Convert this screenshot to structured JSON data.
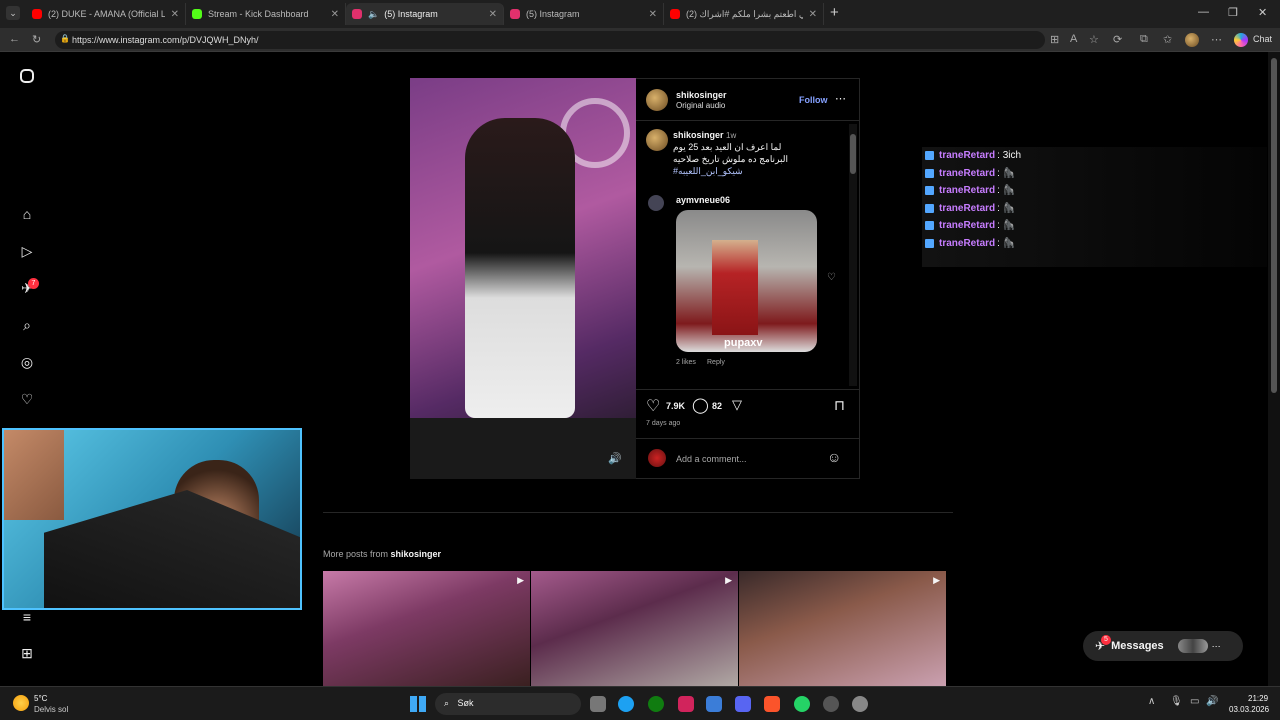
{
  "browser": {
    "tabs": [
      {
        "label": "(2) DUKE - AMANA (Official Lyric V",
        "color": "#ff0000"
      },
      {
        "label": "Stream - Kick Dashboard",
        "color": "#53fc18"
      },
      {
        "label": "(5) Instagram",
        "color": "#e1306c"
      },
      {
        "label": "(5) Instagram",
        "color": "#e1306c"
      },
      {
        "label": "(2) ولني اطعتم بشرا ملكم #اشراك_",
        "color": "#ff0000"
      }
    ],
    "new_tab": "+",
    "url": "https://www.instagram.com/p/DVJQWH_DNyh/",
    "chat_label": "Chat"
  },
  "sidebar": {
    "notifications_badge": "7"
  },
  "post": {
    "username": "shikosinger",
    "audio": "Original audio",
    "follow": "Follow",
    "caption_user": "shikosinger",
    "caption_time": "1w",
    "caption_line1": "لما اعرف ان العيد بعد 25 يوم",
    "caption_line2": "البرنامج ده ملوش تاريخ صلاحيه",
    "caption_hashtag": "#شيكو_ابن_اللعيبه",
    "comment_user": "aymvneue06",
    "comment_watermark": "pupaxv",
    "comment_likes": "2 likes",
    "comment_reply": "Reply",
    "likes": "7.9K",
    "comments": "82",
    "posted": "7 days ago",
    "add_comment_placeholder": "Add a comment..."
  },
  "more_posts": {
    "prefix": "More posts from ",
    "user": "shikosinger"
  },
  "chat_overlay": {
    "lines": [
      {
        "user": "traneRetard",
        "msg": ": 3ich"
      },
      {
        "user": "traneRetard",
        "msg": ": 🦍"
      },
      {
        "user": "traneRetard",
        "msg": ": 🦍"
      },
      {
        "user": "traneRetard",
        "msg": ": 🦍"
      },
      {
        "user": "traneRetard",
        "msg": ": 🦍"
      },
      {
        "user": "traneRetard",
        "msg": ": 🦍"
      }
    ]
  },
  "messages": {
    "label": "Messages",
    "badge": "5"
  },
  "taskbar": {
    "weather_temp": "5°C",
    "weather_desc": "Delvis sol",
    "search": "Søk",
    "time": "21:29",
    "date": "03.03.2026"
  }
}
